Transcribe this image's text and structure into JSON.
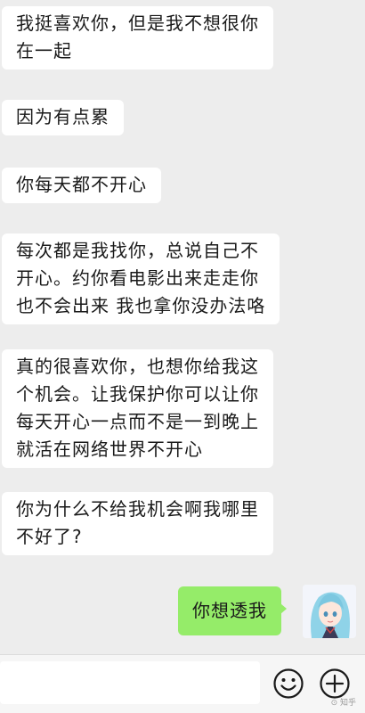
{
  "messages": [
    {
      "from": "other",
      "text": "我挺喜欢你，但是我不想很你\n在一起"
    },
    {
      "from": "other",
      "text": "因为有点累"
    },
    {
      "from": "other",
      "text": "你每天都不开心"
    },
    {
      "from": "other",
      "text": "每次都是我找你，总说自己不\n开心。约你看电影出来走走你\n也不会出来 我也拿你没办法咯"
    },
    {
      "from": "other",
      "text": "真的很喜欢你，也想你给我这\n个机会。让我保护你可以让你\n每天开心一点而不是一到晚上\n就活在网络世界不开心"
    },
    {
      "from": "other",
      "text": "你为什么不给我机会啊我哪里\n不好了?"
    },
    {
      "from": "me",
      "text": "你想透我"
    }
  ],
  "colors": {
    "background": "#ededed",
    "incoming_bubble": "#ffffff",
    "outgoing_bubble": "#95ec69"
  },
  "input_bar": {
    "emoji_icon": "emoji-face-icon",
    "plus_icon": "plus-circle-icon"
  },
  "watermark": "⊙ 知乎"
}
